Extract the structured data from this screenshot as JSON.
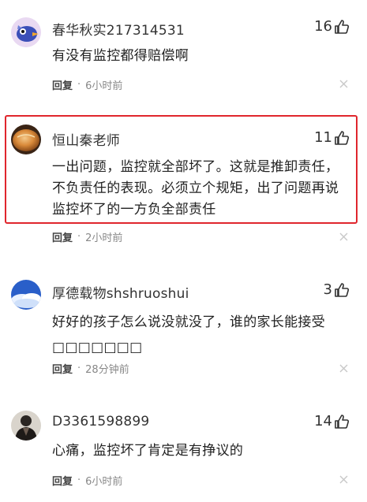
{
  "comments": [
    {
      "username": "春华秋实217314531",
      "likes": "16",
      "text": "有没有监控都得赔偿啊",
      "reply_label": "回复",
      "time": "6小时前",
      "avatar_icon": "bird-cartoon-avatar"
    },
    {
      "username": "恒山秦老师",
      "likes": "11",
      "text": "一出问题，监控就全部坏了。这就是推卸责任，不负责任的表现。必须立个规矩，出了问题再说监控坏了的一方负全部责任",
      "reply_label": "回复",
      "time": "2小时前",
      "avatar_icon": "bread-avatar",
      "highlighted": true,
      "highlight_color": "#e0262d"
    },
    {
      "username": "厚德载物shshruoshui",
      "likes": "3",
      "text": "好好的孩子怎么说没就没了，谁的家长能接受□□□□□□□",
      "reply_label": "回复",
      "time": "28分钟前",
      "avatar_icon": "blue-sky-avatar"
    },
    {
      "username": "D3361598899",
      "likes": "14",
      "text": "心痛，监控坏了肯定是有挣议的",
      "reply_label": "回复",
      "time": "6小时前",
      "avatar_icon": "person-dark-avatar"
    }
  ],
  "icons": {
    "like": "thumbs-up-icon",
    "close": "close-icon"
  }
}
